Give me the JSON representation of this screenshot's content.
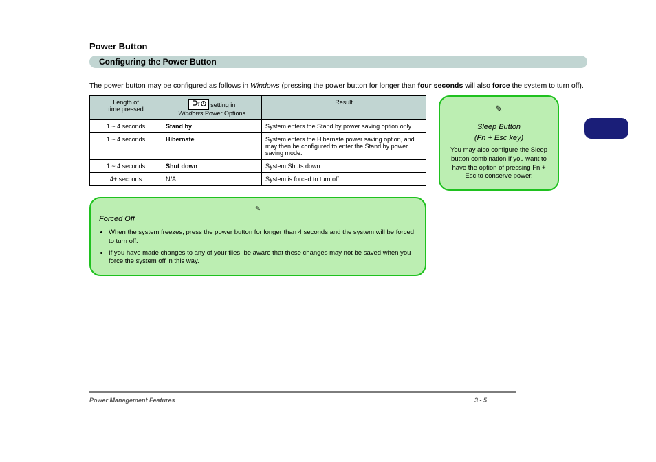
{
  "section_heading": "Power Button",
  "title_bar": "Configuring the Power Button",
  "intro_1": "The power button may be configured as follows in ",
  "intro_2_italic": "Windows",
  "intro_3": " (pressing the power button for longer than ",
  "intro_4_bold": "four seconds",
  "intro_5": " will also ",
  "intro_6_bold": "force",
  "intro_7": " the system to turn off).",
  "side_note": {
    "head1": "Sleep Button",
    "head2": "(Fn + Esc key)",
    "body": "You may also configure the Sleep button combination if you want to have the option of pressing Fn + Esc to conserve power."
  },
  "table": {
    "headers": {
      "col1_line1": "Length of",
      "col1_line2": "time pressed",
      "col2_line1": "      setting in",
      "col2_line2_italic": "Windows",
      "col2_line2_tail": " Power Options",
      "col3": "Result"
    },
    "rows": [
      {
        "time": "1 ~ 4 seconds",
        "setting": "Stand by",
        "result": "System enters the Stand by power saving option only."
      },
      {
        "time": "1 ~ 4 seconds",
        "setting": "Hibernate",
        "result": "System enters the Hibernate power saving option, and may then be configured to enter the Stand by power saving mode."
      },
      {
        "time": "1 ~ 4 seconds",
        "setting": "Shut down",
        "result": "System Shuts down"
      },
      {
        "time": "4+ seconds",
        "setting": "N/A",
        "result": "System is forced to turn off"
      }
    ]
  },
  "big_note": {
    "head": "Forced Off",
    "bullets": [
      "When the system freezes, press the power button for longer than 4 seconds and the system will be forced to turn off.",
      "If you have made changes to any of your files, be aware that these changes may not be saved when you force the system off in this way."
    ]
  },
  "footer_left": "Power Management Features",
  "footer_right": "3 - 5"
}
